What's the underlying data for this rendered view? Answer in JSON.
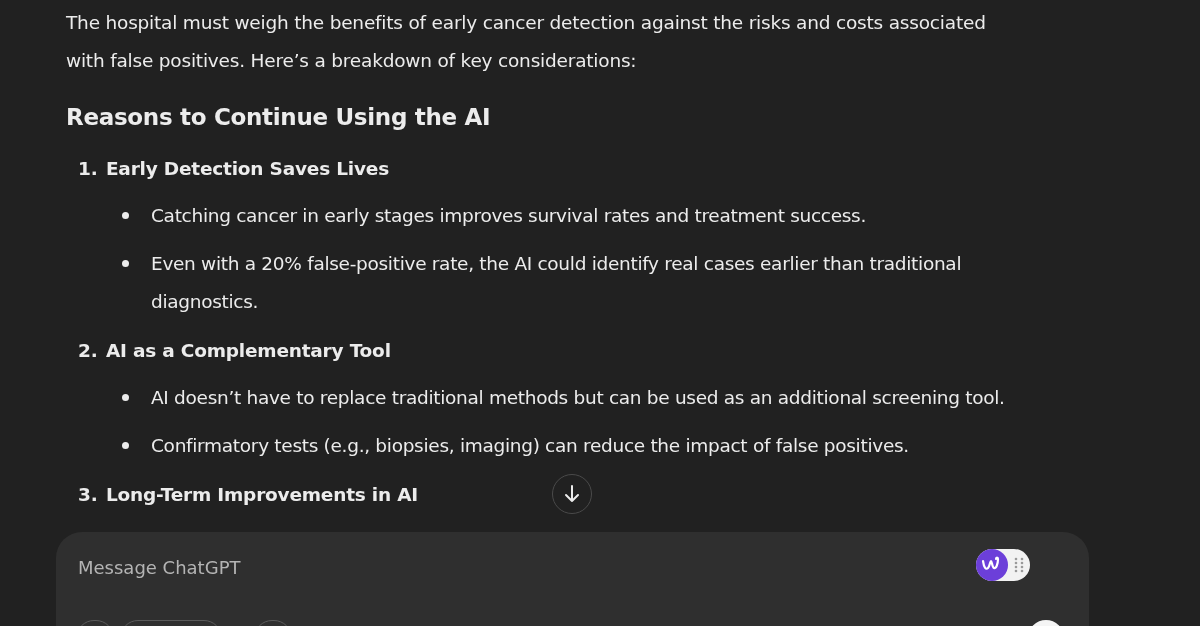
{
  "intro": "The hospital must weigh the benefits of early cancer detection against the risks and costs associated with false positives. Here’s a breakdown of key considerations:",
  "heading": "Reasons to Continue Using the AI",
  "sections": [
    {
      "number": "1.",
      "title": "Early Detection Saves Lives",
      "bullets": [
        "Catching cancer in early stages improves survival rates and treatment success.",
        "Even with a 20% false-positive rate, the AI could identify real cases earlier than traditional diagnostics."
      ]
    },
    {
      "number": "2.",
      "title": "AI as a Complementary Tool",
      "bullets": [
        "AI doesn’t have to replace traditional methods but can be used as an additional screening tool.",
        "Confirmatory tests (e.g., biopsies, imaging) can reduce the impact of false positives."
      ]
    },
    {
      "number": "3.",
      "title": "Long-Term Improvements in AI"
    }
  ],
  "composer": {
    "placeholder": "Message ChatGPT"
  }
}
